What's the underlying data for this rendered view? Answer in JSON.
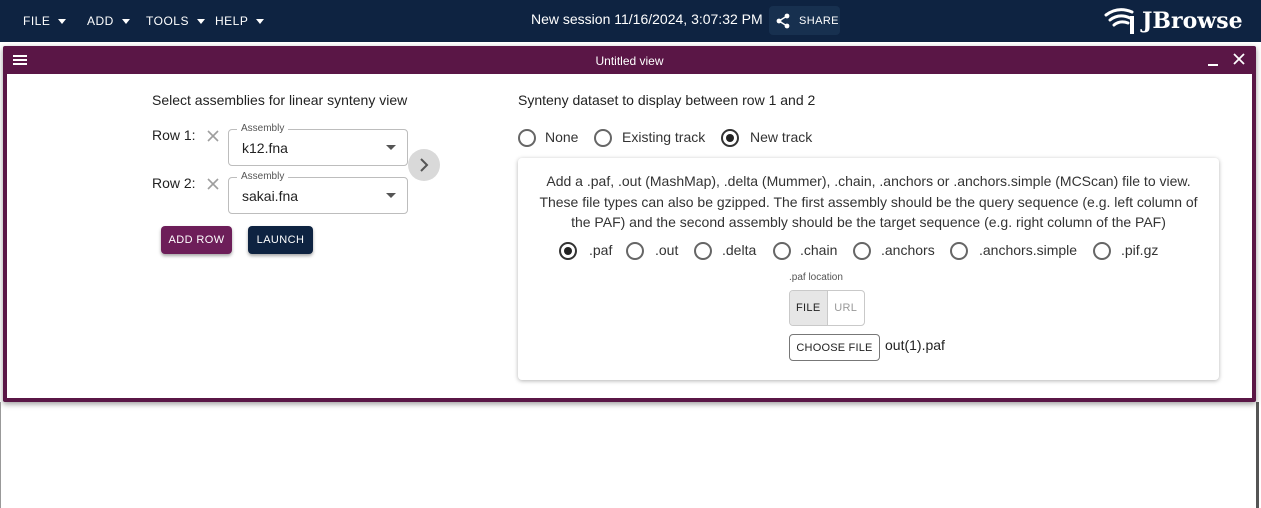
{
  "appbar": {
    "menus": [
      "FILE",
      "ADD",
      "TOOLS",
      "HELP"
    ],
    "session_title": "New session 11/16/2024, 3:07:32 PM",
    "share_label": "SHARE",
    "logo_text": "JBrowse"
  },
  "view": {
    "title": "Untitled view",
    "left": {
      "heading": "Select assemblies for linear synteny view",
      "rows": [
        {
          "label": "Row 1:",
          "legend": "Assembly",
          "value": "k12.fna"
        },
        {
          "label": "Row 2:",
          "legend": "Assembly",
          "value": "sakai.fna"
        }
      ],
      "add_row_label": "ADD ROW",
      "launch_label": "LAUNCH"
    },
    "right": {
      "heading": "Synteny dataset to display between row 1 and 2",
      "dataset_options": [
        {
          "label": "None",
          "checked": false
        },
        {
          "label": "Existing track",
          "checked": false
        },
        {
          "label": "New track",
          "checked": true
        }
      ],
      "description": "Add a .paf, .out (MashMap), .delta (Mummer), .chain, .anchors or .anchors.simple (MCScan) file to view. These file types can also be gzipped. The first assembly should be the query sequence (e.g. left column of the PAF) and the second assembly should be the target sequence (e.g. right column of the PAF)",
      "formats": [
        {
          "label": ".paf",
          "checked": true
        },
        {
          "label": ".out",
          "checked": false
        },
        {
          "label": ".delta",
          "checked": false
        },
        {
          "label": ".chain",
          "checked": false
        },
        {
          "label": ".anchors",
          "checked": false
        },
        {
          "label": ".anchors.simple",
          "checked": false
        },
        {
          "label": ".pif.gz",
          "checked": false
        }
      ],
      "location_label": ".paf location",
      "toggle_file": "FILE",
      "toggle_url": "URL",
      "choose_file_label": "CHOOSE FILE",
      "file_name": "out(1).paf"
    }
  },
  "colors": {
    "appbar": "#0e2341",
    "view_header": "#5a1646",
    "add_row_button": "#6d1e59",
    "launch_button": "#0e2341"
  }
}
